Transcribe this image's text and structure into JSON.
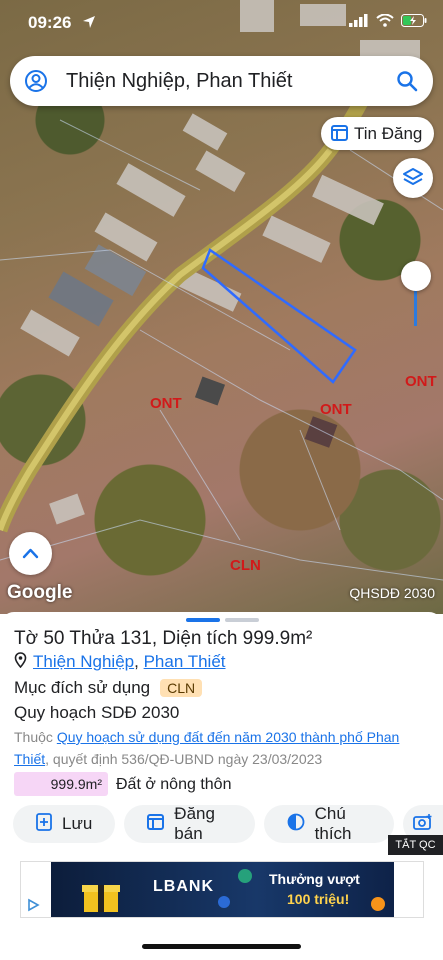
{
  "status_bar": {
    "time": "09:26"
  },
  "search": {
    "query": "Thiện Nghiệp, Phan Thiết"
  },
  "map": {
    "post_button_label": "Tin Đăng",
    "zone_labels": {
      "ont_left": "ONT",
      "ont_center": "ONT",
      "ont_right": "ONT",
      "cln": "CLN"
    },
    "attribution": "Google",
    "layer_name": "QHSDĐ 2030"
  },
  "parcel": {
    "title": "Tờ 50 Thửa 131, Diện tích 999.9m²",
    "ward": "Thiện Nghiệp",
    "sep": ",",
    "city": "Phan Thiết",
    "purpose_label": "Mục đích sử dụng",
    "purpose_code": "CLN",
    "plan_title": "Quy hoạch SDĐ 2030",
    "belongs_prefix": "Thuộc",
    "plan_link": "Quy hoạch sử dụng đất đến năm 2030 thành phố Phan Thiết",
    "decision": ", quyết định 536/QĐ-UBND ngày 23/03/2023",
    "area_value": "999.9m²",
    "area_label": "Đất ở nông thôn"
  },
  "actions": {
    "save": "Lưu",
    "sell": "Đăng bán",
    "legend": "Chú thích"
  },
  "ad": {
    "close_label": "TẮT QC",
    "brand": "LBANK",
    "line1": "Thưởng vượt",
    "line2": "100 triệu!"
  },
  "colors": {
    "accent": "#1a73e8",
    "parcel_outline": "#2f6bff",
    "zone_text": "#d11a1a",
    "cln_badge": "#ffe0b3",
    "area_badge": "#f6d6f6"
  }
}
